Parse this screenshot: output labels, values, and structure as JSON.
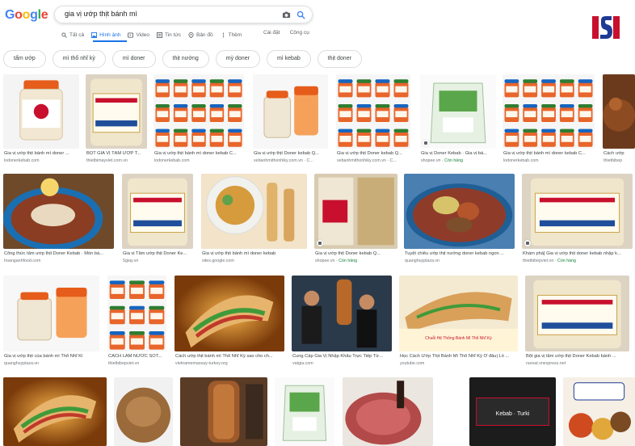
{
  "google": {
    "logo_letters": [
      "G",
      "o",
      "o",
      "g",
      "l",
      "e"
    ]
  },
  "search": {
    "query": "gia vị ướp thịt bánh mì"
  },
  "tabs": [
    {
      "label": "Tất cả",
      "icon": "search-icon",
      "active": false
    },
    {
      "label": "Hình ảnh",
      "icon": "image-icon",
      "active": true
    },
    {
      "label": "Video",
      "icon": "video-icon",
      "active": false
    },
    {
      "label": "Tin tức",
      "icon": "news-icon",
      "active": false
    },
    {
      "label": "Bản đồ",
      "icon": "map-pin-icon",
      "active": false
    },
    {
      "label": "Thêm",
      "icon": "more-icon",
      "active": false
    }
  ],
  "tools": {
    "settings": "Cài đặt",
    "tools": "Công cụ"
  },
  "chips": [
    "tẩm ướp",
    "mì thổ nhĩ kỳ",
    "mì doner",
    "thịt nướng",
    "mỳ doner",
    "mì kebab",
    "thịt doner"
  ],
  "images": [
    {
      "caption": "Gia vị ướp thịt bánh mì doner ...",
      "source": "lodonerkebab.com",
      "stock": ""
    },
    {
      "caption": "BỘT GIA VỊ TẨM ƯỚP T...",
      "source": "thietbimayviet.com.vn",
      "stock": ""
    },
    {
      "caption": "Gia vị ướp thịt bánh mì doner kebab C...",
      "source": "lodonerkebab.com",
      "stock": ""
    },
    {
      "caption": "Gia vị ướp thịt Doner kebab Q...",
      "source": "xebanhmithonhiky.com.vn · C...",
      "stock": ""
    },
    {
      "caption": "Gia vị ướp thịt Doner kebab Q...",
      "source": "xebanhmithonhiky.com.vn · C...",
      "stock": ""
    },
    {
      "caption": "Gia vị Doner Kebab · Gia vị bá...",
      "source": "shopee.vn · ",
      "stock": "Còn hàng"
    },
    {
      "caption": "Gia vị ướp thịt bánh mì doner kebab C...",
      "source": "lodonerkebab.com",
      "stock": ""
    },
    {
      "caption": "Cách ướp",
      "source": "thietbibep",
      "stock": ""
    },
    {
      "caption": "Công thức tẩm ướp thịt Doner Kebab · Món bá...",
      "source": "hoanganhfood.com",
      "stock": ""
    },
    {
      "caption": "Gia vị Tẩm ướp thịt Doner Ke...",
      "source": "5giay.vn",
      "stock": ""
    },
    {
      "caption": "Gia vị ướp thịt bánh mì doner kebab",
      "source": "sites.google.com",
      "stock": ""
    },
    {
      "caption": "Gia vị ướp thịt Doner kebab Q...",
      "source": "shopee.vn · ",
      "stock": "Còn hàng"
    },
    {
      "caption": "Tuyệt chiêu ướp thịt nướng doner kebab ngon ...",
      "source": "quanghuyplaza.vn",
      "stock": ""
    },
    {
      "caption": "Khám phá] Gia vị ướp thịt doner kebab nhập k...",
      "source": "thietbibepviet.vn · ",
      "stock": "Còn hàng"
    },
    {
      "caption": "Gia vị ướp thịt của bánh mì Thổ Nhĩ Kì",
      "source": "quanghuyplaza.vn",
      "stock": ""
    },
    {
      "caption": "CÁCH LÀM NƯỚC SỐT...",
      "source": "thietbibepviet.vn",
      "stock": ""
    },
    {
      "caption": "Cách ướp thịt bánh mì Thổ Nhĩ Kỳ sao cho ch...",
      "source": "vietnamemassay-turkey.org",
      "stock": ""
    },
    {
      "caption": "Cung Cấp Gia Vị Nhập Khẩu Trực Tiếp Từ...",
      "source": "vatgia.com",
      "stock": ""
    },
    {
      "caption": "Học Cách Ướp Thịt Bánh Mì Thổ Nhĩ Kỳ Ở đâu| Lò ...",
      "source": "youtube.com",
      "stock": ""
    },
    {
      "caption": "Bột gia vị tẩm ướp thịt Doner Kebab bánh ...",
      "source": "raovat.vnexpress.net",
      "stock": ""
    },
    {
      "caption": "",
      "source": "",
      "stock": ""
    },
    {
      "caption": "",
      "source": "",
      "stock": ""
    },
    {
      "caption": "",
      "source": "",
      "stock": ""
    },
    {
      "caption": "",
      "source": "",
      "stock": ""
    },
    {
      "caption": "",
      "source": "",
      "stock": ""
    },
    {
      "caption": "",
      "source": "",
      "stock": ""
    },
    {
      "caption": "",
      "source": "",
      "stock": ""
    }
  ],
  "image_texts": {
    "kebab_label": "DONER KEBAB",
    "spice_label": "GIA VỊ TẨM ƯỚP THỊT",
    "banner_text": "Chuỗi Hệ Thống Bánh Mì Thổ Nhĩ Kỳ",
    "kebab_sign": "Kebab · Turki"
  },
  "colors": {
    "accent": "#1a73e8",
    "stock_green": "#188038",
    "brand_red": "#c8102e",
    "brand_blue": "#1f3a93"
  }
}
